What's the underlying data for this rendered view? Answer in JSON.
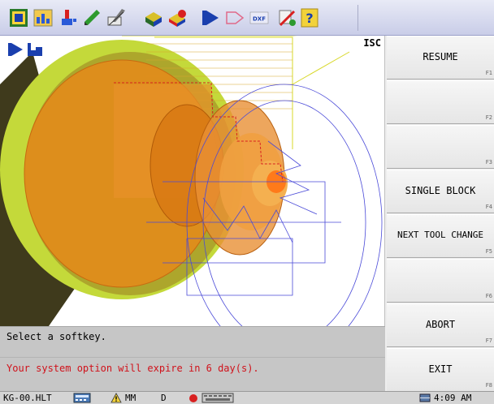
{
  "toolbar": {
    "icons": [
      "program-icon",
      "graphics-icon",
      "tool-icon",
      "pencil-icon",
      "edit-icon",
      "solid-model-icon",
      "part-icon",
      "play-icon",
      "arrow-outline-icon",
      "dxf-icon",
      "config-icon",
      "help-icon"
    ],
    "dxf_label": "DXF"
  },
  "view": {
    "label": "ISC"
  },
  "messages": {
    "prompt": "Select a softkey.",
    "warning": "Your system option will expire in 6 day(s).",
    "warning_color": "#d0121b"
  },
  "softkeys": [
    {
      "label": "RESUME",
      "fkey": "F1"
    },
    {
      "label": "",
      "fkey": "F2"
    },
    {
      "label": "",
      "fkey": "F3"
    },
    {
      "label": "SINGLE BLOCK",
      "fkey": "F4"
    },
    {
      "label": "NEXT TOOL CHANGE",
      "fkey": "F5"
    },
    {
      "label": "",
      "fkey": "F6"
    },
    {
      "label": "ABORT",
      "fkey": "F7"
    },
    {
      "label": "EXIT",
      "fkey": "F8"
    }
  ],
  "status": {
    "filename": "KG-00.HLT",
    "units": "MM",
    "mode": "D",
    "time": "4:09 AM"
  },
  "colors": {
    "part": "#e58a1a",
    "stock": "#c4d93a",
    "wire": "#4a4ad8"
  }
}
